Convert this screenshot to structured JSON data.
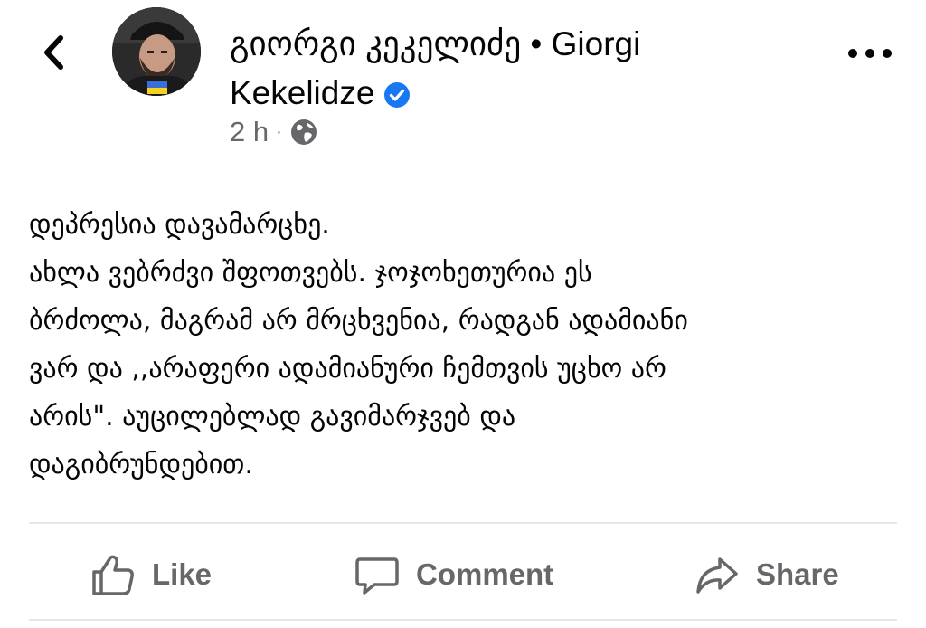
{
  "header": {
    "author_line1": "გიორგი კეკელიძე • Giorgi",
    "author_line2": "Kekelidze",
    "timestamp": "2 h",
    "separator": "·"
  },
  "post": {
    "lines": [
      "დეპრესია დავამარცხე.",
      "ახლა ვებრძვი შფოთვებს. ჯოჯოხეთურია ეს",
      "ბრძოლა, მაგრამ არ მრცხვენია, რადგან ადამიანი",
      "ვარ და ,,არაფერი ადამიანური ჩემთვის უცხო არ",
      "არის\". აუცილებლად გავიმარჯვებ და",
      "დაგიბრუნდებით."
    ]
  },
  "actions": {
    "like_label": "Like",
    "comment_label": "Comment",
    "share_label": "Share"
  },
  "icons": {
    "back": "chevron-left-icon",
    "verified": "verified-badge-icon",
    "audience": "globe-icon",
    "more": "more-dots-icon",
    "like": "thumbs-up-icon",
    "comment": "speech-bubble-icon",
    "share": "share-arrow-icon"
  },
  "colors": {
    "verified_blue": "#1877f2",
    "secondary_text": "#65676b",
    "divider": "#e4e6eb",
    "flag_blue": "#3b6fd8",
    "flag_yellow": "#f5d21d"
  }
}
